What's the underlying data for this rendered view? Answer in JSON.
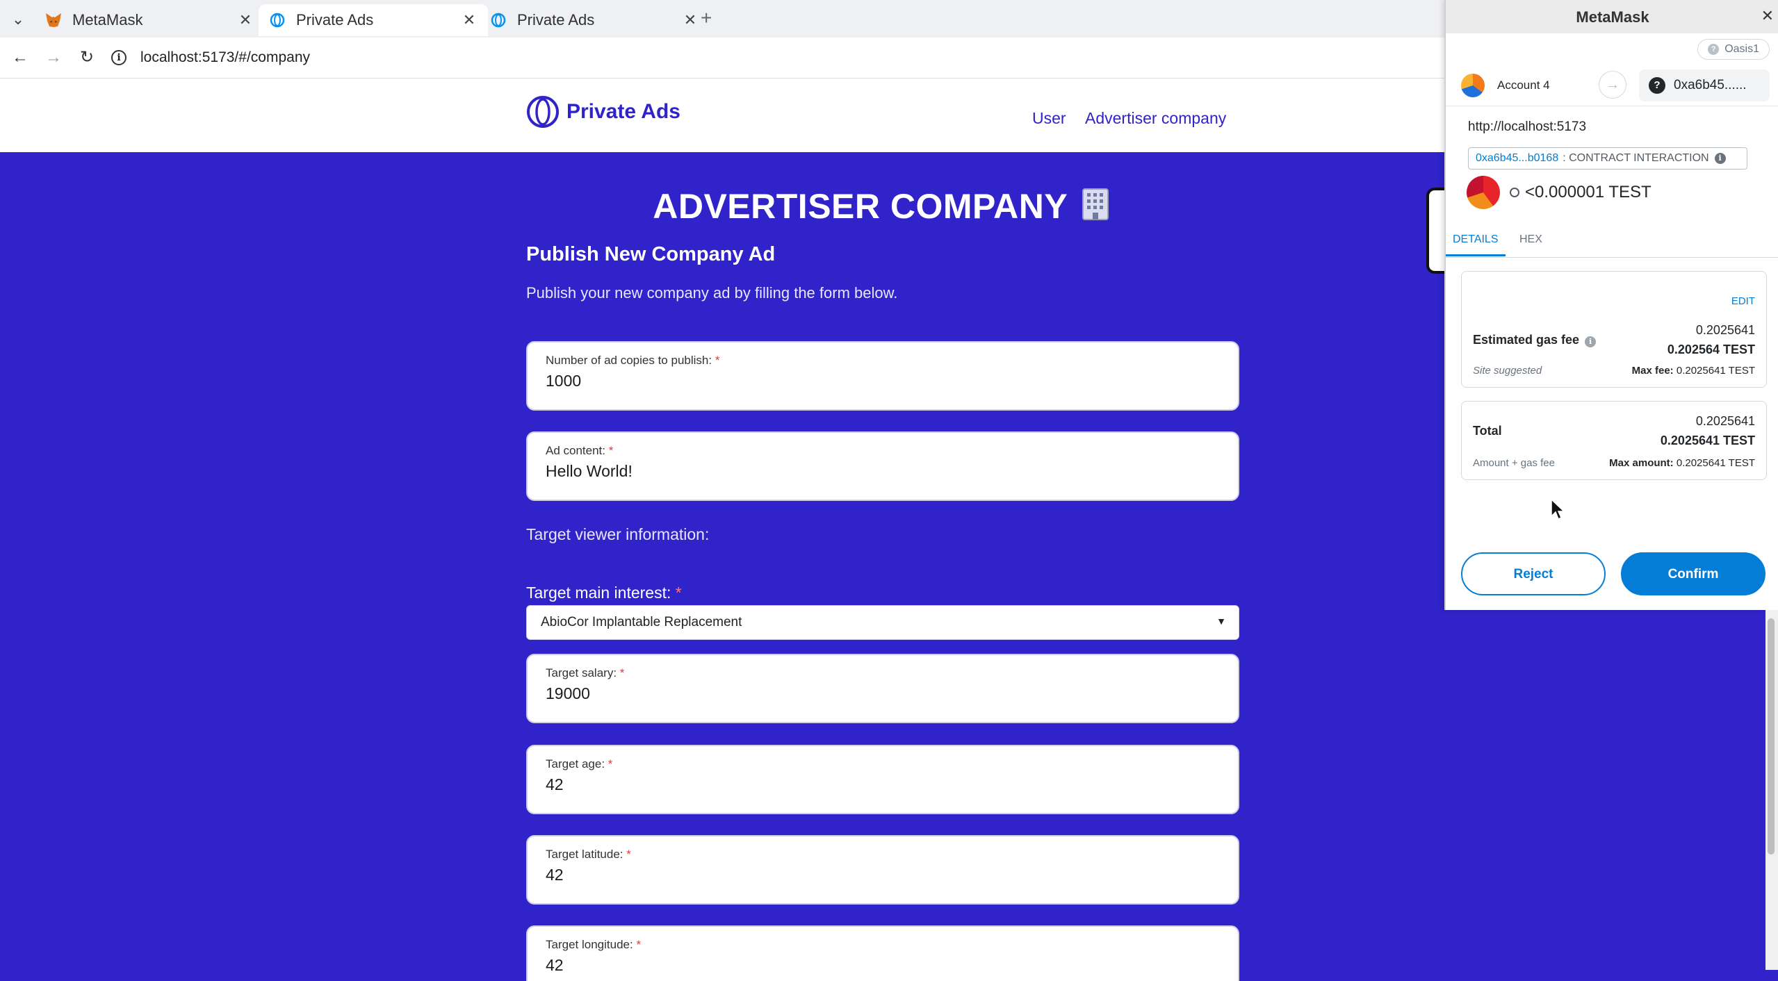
{
  "browser": {
    "tabs": [
      {
        "title": "MetaMask",
        "icon": "fox-icon",
        "active": false
      },
      {
        "title": "Private Ads",
        "icon": "oasis-icon",
        "active": true
      },
      {
        "title": "Private Ads",
        "icon": "oasis-icon",
        "active": false
      }
    ],
    "url": "localhost:5173/#/company"
  },
  "header": {
    "brand": "Private Ads",
    "nav": [
      "User",
      "Advertiser company"
    ]
  },
  "page": {
    "title": "ADVERTISER COMPANY",
    "title_icon": "office-building-emoji",
    "subtitle": "Publish New Company Ad",
    "intro": "Publish your new company ad by filling the form below.",
    "target_section": "Target viewer information:",
    "required_mark": "*"
  },
  "form": {
    "copies": {
      "label": "Number of ad copies to publish:",
      "value": "1000"
    },
    "content": {
      "label": "Ad content:",
      "value": "Hello World!"
    },
    "interest": {
      "label": "Target main interest:",
      "value": "AbioCor Implantable Replacement"
    },
    "salary": {
      "label": "Target salary:",
      "value": "19000"
    },
    "age": {
      "label": "Target age:",
      "value": "42"
    },
    "latitude": {
      "label": "Target latitude:",
      "value": "42"
    },
    "longitude": {
      "label": "Target longitude:",
      "value": "42"
    }
  },
  "metamask": {
    "title": "MetaMask",
    "network": "Oasis1",
    "from_account": "Account 4",
    "to_account": "0xa6b45......",
    "origin": "http://localhost:5173",
    "contract_address": "0xa6b45...b0168",
    "contract_label": ": CONTRACT INTERACTION",
    "amount": "<0.000001 TEST",
    "tabs": [
      "DETAILS",
      "HEX"
    ],
    "edit": "EDIT",
    "gas": {
      "label": "Estimated gas fee",
      "value": "0.2025641",
      "value_bold": "0.202564 TEST",
      "hint": "Site suggested",
      "max_label": "Max fee:",
      "max_value": "0.2025641 TEST"
    },
    "total": {
      "label": "Total",
      "value": "0.2025641",
      "value_bold": "0.2025641 TEST",
      "hint": "Amount + gas fee",
      "max_label": "Max amount:",
      "max_value": "0.2025641 TEST"
    },
    "reject": "Reject",
    "confirm": "Confirm",
    "colors": {
      "primary": "#037dd6",
      "page_bg": "#3023c9"
    }
  }
}
